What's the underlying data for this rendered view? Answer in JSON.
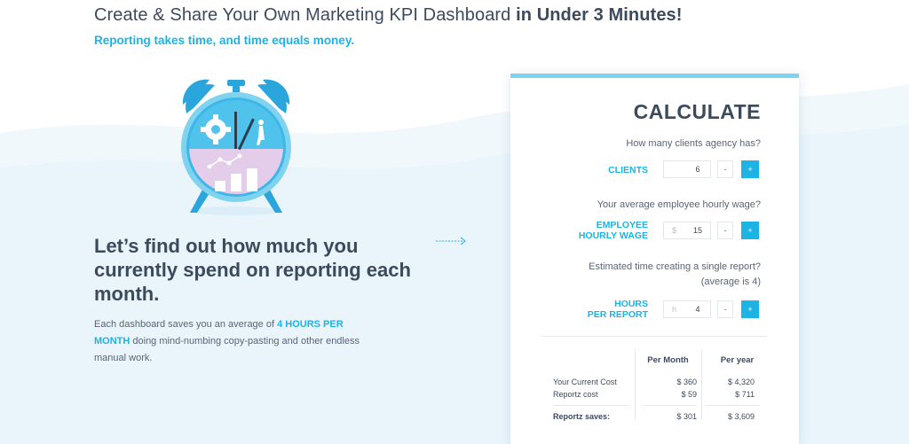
{
  "header": {
    "title_part1": "Create & Share Your Own Marketing KPI Dashboard ",
    "title_bold": "in Under 3 Minutes!",
    "subtitle": "Reporting takes time, and time equals money."
  },
  "left": {
    "headline": "Let’s find out how much you currently spend on reporting each month.",
    "para_part1": "Each dashboard saves you an average of ",
    "para_highlight": "4 HOURS PER MONTH",
    "para_part2": " doing mind-numbing copy-pasting and other endless manual work."
  },
  "calc": {
    "title": "CALCULATE",
    "clients": {
      "question": "How many clients agency has?",
      "label": "CLIENTS",
      "value": "6",
      "minus": "-",
      "plus": "+"
    },
    "wage": {
      "question": "Your average employee hourly wage?",
      "label_line1": "EMPLOYEE",
      "label_line2": "HOURLY WAGE",
      "prefix": "$",
      "value": "15",
      "minus": "-",
      "plus": "+"
    },
    "hours": {
      "question_line1": "Estimated time creating a single report?",
      "question_line2": "(average is 4)",
      "label_line1": "HOURS",
      "label_line2": "PER REPORT",
      "prefix": "h",
      "value": "4",
      "minus": "-",
      "plus": "+"
    },
    "table": {
      "col_month": "Per Month",
      "col_year": "Per year",
      "rows": [
        {
          "label": "Your Current Cost",
          "month": "$ 360",
          "year": "$ 4,320"
        },
        {
          "label": "Reportz cost",
          "month": "$ 59",
          "year": "$ 711"
        }
      ],
      "savings": {
        "label": "Reportz saves:",
        "month": "$ 301",
        "year": "$ 3,609"
      }
    }
  },
  "colors": {
    "accent": "#1cb3e5",
    "text": "#3d4a5c",
    "clock_face": "#4fc3ec",
    "clock_bottom": "#e3cdea"
  }
}
